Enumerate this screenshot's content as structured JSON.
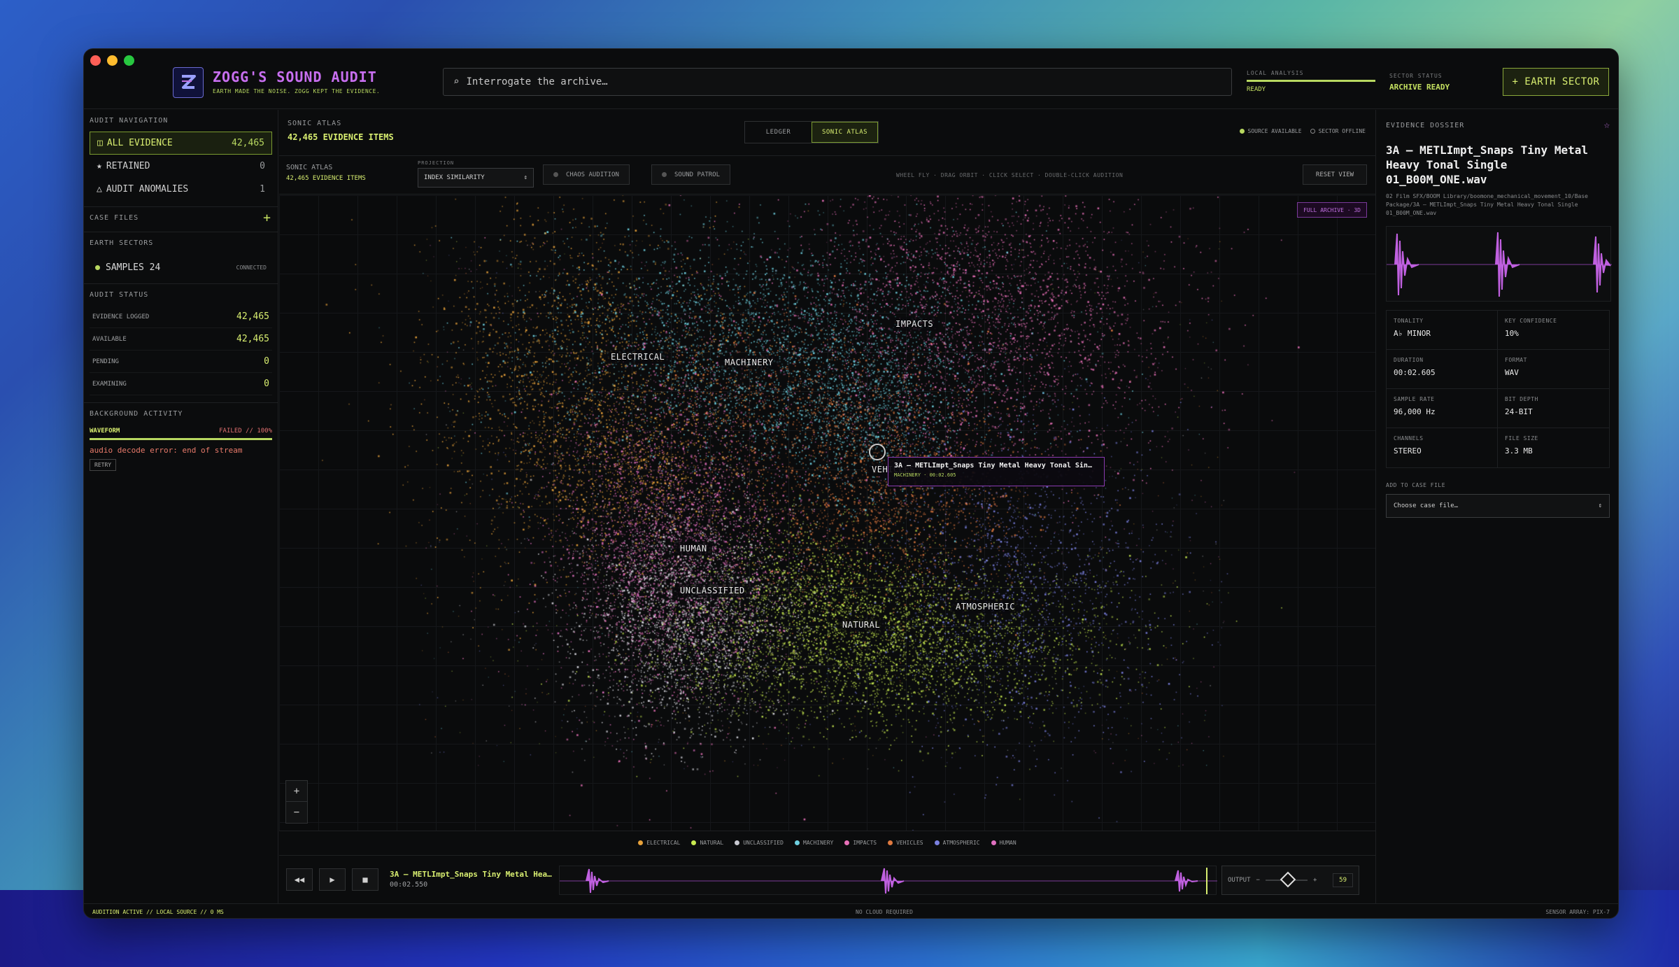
{
  "app": {
    "title": "ZOGG'S SOUND AUDIT",
    "subtitle": "EARTH MADE THE NOISE. ZOGG KEPT THE EVIDENCE.",
    "search_placeholder": "Interrogate the archive…",
    "local_analysis_label": "LOCAL ANALYSIS",
    "local_analysis_value": "READY",
    "sector_status_label": "SECTOR STATUS",
    "sector_status_value": "ARCHIVE READY",
    "earth_sector_button": "+ EARTH SECTOR"
  },
  "sidebar": {
    "nav_title": "AUDIT NAVIGATION",
    "nav": [
      {
        "icon": "grid-icon",
        "glyph": "◫",
        "label": "ALL EVIDENCE",
        "count": "42,465"
      },
      {
        "icon": "star-icon",
        "glyph": "★",
        "label": "RETAINED",
        "count": "0"
      },
      {
        "icon": "warning-icon",
        "glyph": "△",
        "label": "AUDIT ANOMALIES",
        "count": "1"
      }
    ],
    "case_files_title": "CASE FILES",
    "case_add": "+",
    "earth_sectors_title": "EARTH SECTORS",
    "sector_name": "SAMPLES 24",
    "sector_state": "CONNECTED",
    "audit_status_title": "AUDIT STATUS",
    "stats": [
      {
        "label": "EVIDENCE LOGGED",
        "value": "42,465"
      },
      {
        "label": "AVAILABLE",
        "value": "42,465"
      },
      {
        "label": "PENDING",
        "value": "0"
      },
      {
        "label": "EXAMINING",
        "value": "0"
      }
    ],
    "bg_title": "BACKGROUND ACTIVITY",
    "bg_task": "WAVEFORM",
    "bg_state": "FAILED // 100%",
    "bg_progress": 100,
    "bg_error": "audio decode error: end of stream",
    "bg_retry": "RETRY"
  },
  "center": {
    "label": "SONIC ATLAS",
    "count": "42,465 EVIDENCE ITEMS",
    "tabs": [
      "LEDGER",
      "SONIC ATLAS"
    ],
    "active_tab": "SONIC ATLAS",
    "source_available": "SOURCE AVAILABLE",
    "sector_offline": "SECTOR OFFLINE",
    "toolbar_label": "SONIC ATLAS",
    "toolbar_count": "42,465 EVIDENCE ITEMS",
    "projection_label": "PROJECTION",
    "projection_value": "INDEX SIMILARITY",
    "chaos_button": "CHAOS AUDITION",
    "patrol_button": "SOUND PATROL",
    "hint": "WHEEL FLY · DRAG ORBIT · CLICK SELECT · DOUBLE-CLICK AUDITION",
    "reset_button": "RESET VIEW",
    "archive_badge": "FULL ARCHIVE · 3D",
    "clusters": [
      {
        "name": "ELECTRICAL",
        "color": "#e8a23a"
      },
      {
        "name": "MACHINERY",
        "color": "#6ed0e0"
      },
      {
        "name": "IMPACTS",
        "color": "#e870b8"
      },
      {
        "name": "VEHICLES",
        "color": "#e07a40"
      },
      {
        "name": "HUMAN",
        "color": "#e070c0"
      },
      {
        "name": "UNCLASSIFIED",
        "color": "#e0e0e8"
      },
      {
        "name": "NATURAL",
        "color": "#c8ea50"
      },
      {
        "name": "ATMOSPHERIC",
        "color": "#7a80e0"
      }
    ],
    "tooltip_title": "3A – METLImpt_Snaps Tiny Metal Heavy Tonal Sin…",
    "tooltip_meta": "MACHINERY · 00:02.605",
    "zoom_in": "+",
    "zoom_out": "−",
    "legend": [
      {
        "name": "ELECTRICAL",
        "color": "#e8a23a"
      },
      {
        "name": "NATURAL",
        "color": "#c8ea50"
      },
      {
        "name": "UNCLASSIFIED",
        "color": "#c8c8d0"
      },
      {
        "name": "MACHINERY",
        "color": "#6ed0e0"
      },
      {
        "name": "IMPACTS",
        "color": "#e870b8"
      },
      {
        "name": "VEHICLES",
        "color": "#e07a40"
      },
      {
        "name": "ATMOSPHERIC",
        "color": "#7a80e0"
      },
      {
        "name": "HUMAN",
        "color": "#e070c0"
      }
    ]
  },
  "player": {
    "rewind": "◀◀",
    "play": "▶",
    "stop": "■",
    "title": "3A – METLImpt_Snaps Tiny Metal Hea…",
    "time": "00:02.550",
    "output_label": "OUTPUT",
    "vol_minus": "−",
    "vol_plus": "+",
    "volume": "59"
  },
  "dossier": {
    "title": "EVIDENCE DOSSIER",
    "star": "☆",
    "name": "3A – METLImpt_Snaps Tiny Metal Heavy Tonal Single 01_B00M_ONE.wav",
    "path": "02 Film SFX/BOOM Library/boomone_mechanical_movement_10/Base Package/3A – METLImpt_Snaps Tiny Metal Heavy Tonal Single 01_B00M_ONE.wav",
    "fields": [
      {
        "label": "TONALITY",
        "value": "A♭ MINOR"
      },
      {
        "label": "KEY CONFIDENCE",
        "value": "10%"
      },
      {
        "label": "DURATION",
        "value": "00:02.605"
      },
      {
        "label": "FORMAT",
        "value": "WAV"
      },
      {
        "label": "SAMPLE RATE",
        "value": "96,000 Hz"
      },
      {
        "label": "BIT DEPTH",
        "value": "24-BIT"
      },
      {
        "label": "CHANNELS",
        "value": "STEREO"
      },
      {
        "label": "FILE SIZE",
        "value": "3.3 MB"
      }
    ],
    "add_case_label": "ADD TO CASE FILE",
    "case_placeholder": "Choose case file…"
  },
  "footer": {
    "left": "AUDITION ACTIVE // LOCAL SOURCE // 0 MS",
    "center": "NO CLOUD REQUIRED",
    "right": "SENSOR ARRAY: PIX-7"
  },
  "colors": {
    "accent": "#c4e060",
    "purple": "#c070e0",
    "error": "#e87a6a"
  }
}
